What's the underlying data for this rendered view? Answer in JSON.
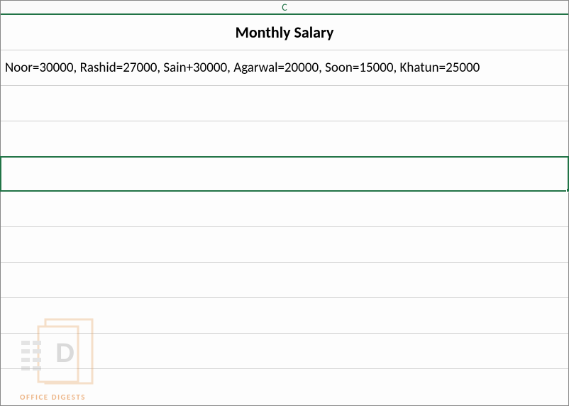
{
  "column_label": "C",
  "rows": {
    "title": "Monthly Salary",
    "data_line": "Noor=30000, Rashid=27000, Sain+30000, Agarwal=20000, Soon=15000, Khatun=25000"
  },
  "watermark": {
    "letter": "D",
    "brand": "OFFICE DIGESTS"
  },
  "colors": {
    "excel_green": "#217346",
    "wm_orange": "#e48a3f"
  }
}
